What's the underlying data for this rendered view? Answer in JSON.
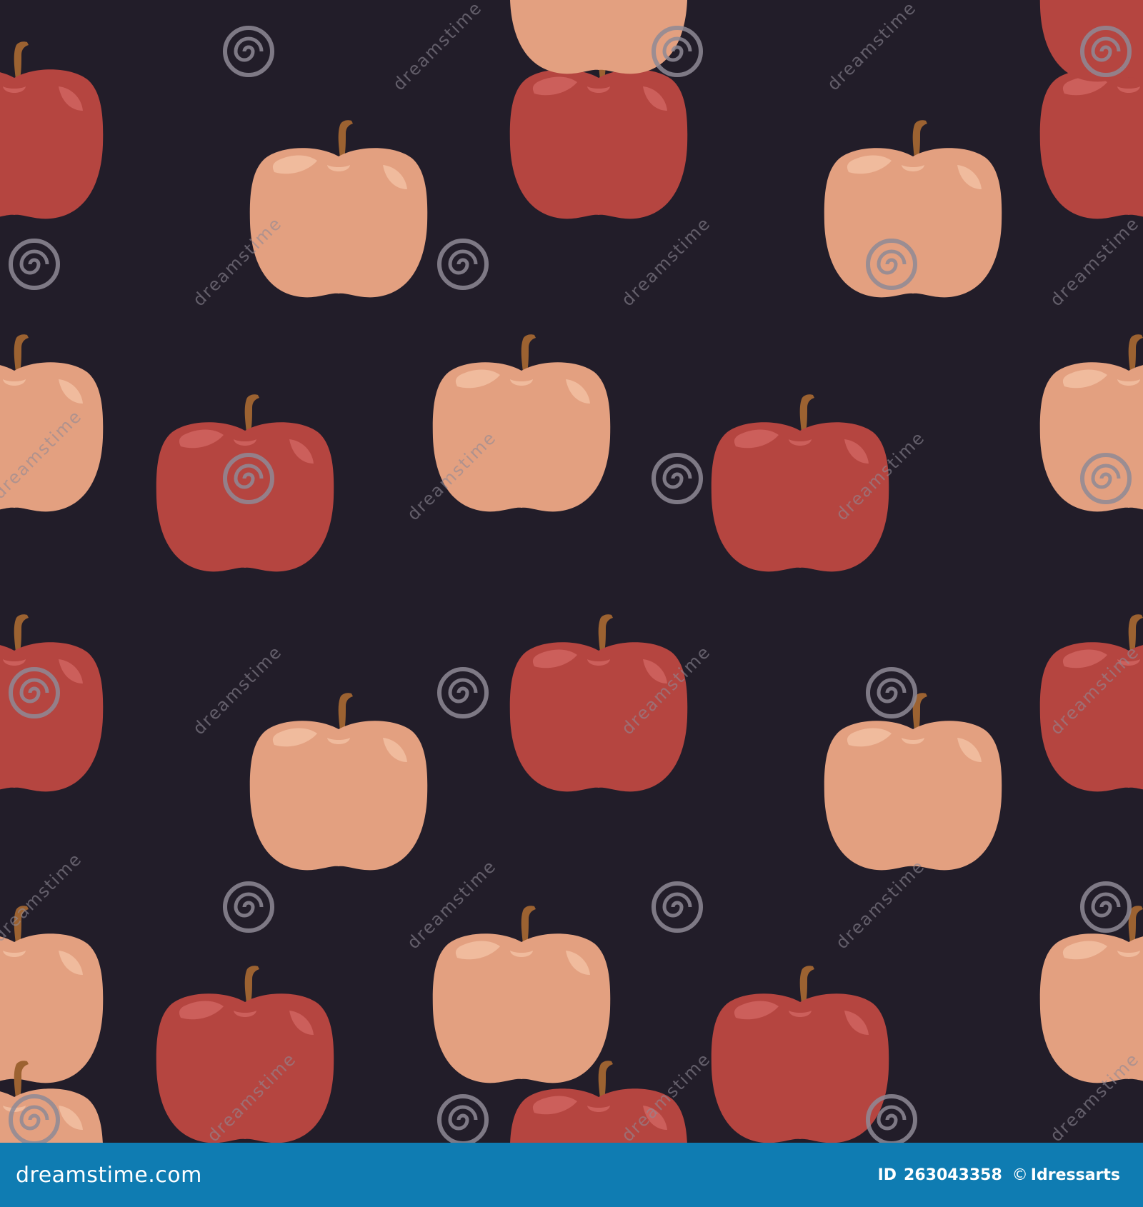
{
  "image": {
    "subject": "seamless apple pattern",
    "colors": {
      "background": "#221d29",
      "red_apple": "#b54540",
      "red_apple_highlight": "#cc5f5b",
      "pale_apple": "#e3a080",
      "pale_apple_highlight": "#f0bb9d",
      "stem": "#9c6231",
      "watermark": "#8f8a96",
      "footer": "#0f7cb2"
    },
    "apples": [
      {
        "variant": "red"
      },
      {
        "variant": "pale"
      },
      {
        "variant": "red"
      },
      {
        "variant": "pale"
      },
      {
        "variant": "red"
      },
      {
        "variant": "pale"
      },
      {
        "variant": "red"
      },
      {
        "variant": "pale"
      },
      {
        "variant": "red"
      },
      {
        "variant": "pale"
      },
      {
        "variant": "red"
      },
      {
        "variant": "pale"
      },
      {
        "variant": "red"
      },
      {
        "variant": "pale"
      },
      {
        "variant": "red"
      },
      {
        "variant": "pale"
      },
      {
        "variant": "red"
      },
      {
        "variant": "pale"
      },
      {
        "variant": "red"
      },
      {
        "variant": "pale"
      },
      {
        "variant": "red"
      },
      {
        "variant": "pale"
      },
      {
        "variant": "red"
      },
      {
        "variant": "pale"
      }
    ]
  },
  "watermark": {
    "text": "dreamstime",
    "icon": "spiral-icon"
  },
  "footer": {
    "brand": "dreamstime.com",
    "id_label": "ID",
    "id_number": "263043358",
    "copyright": "©",
    "author": "Idressarts"
  }
}
